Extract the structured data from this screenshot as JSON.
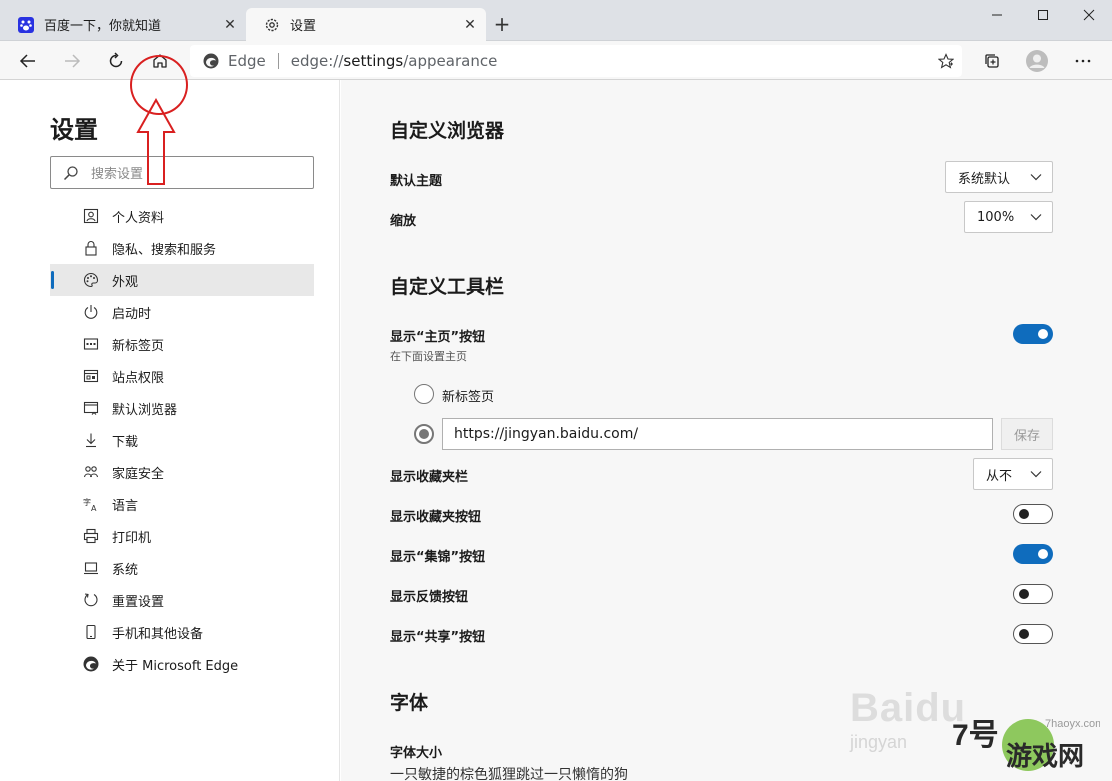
{
  "browser": {
    "tabs": [
      {
        "title": "百度一下，你就知道",
        "icon": "baidu-paw-icon",
        "active": false
      },
      {
        "title": "设置",
        "icon": "gear-icon",
        "active": true
      }
    ],
    "address": {
      "label": "Edge",
      "url_scheme": "edge://",
      "url_host": "settings",
      "url_path": "/appearance"
    }
  },
  "sidebar": {
    "title": "设置",
    "search_placeholder": "搜索设置",
    "items": [
      {
        "label": "个人资料",
        "icon": "profile-icon"
      },
      {
        "label": "隐私、搜索和服务",
        "icon": "lock-icon"
      },
      {
        "label": "外观",
        "icon": "palette-icon",
        "active": true
      },
      {
        "label": "启动时",
        "icon": "power-icon"
      },
      {
        "label": "新标签页",
        "icon": "new-tab-icon"
      },
      {
        "label": "站点权限",
        "icon": "site-permissions-icon"
      },
      {
        "label": "默认浏览器",
        "icon": "default-browser-icon"
      },
      {
        "label": "下载",
        "icon": "download-icon"
      },
      {
        "label": "家庭安全",
        "icon": "family-icon"
      },
      {
        "label": "语言",
        "icon": "language-icon"
      },
      {
        "label": "打印机",
        "icon": "printer-icon"
      },
      {
        "label": "系统",
        "icon": "system-icon"
      },
      {
        "label": "重置设置",
        "icon": "reset-icon"
      },
      {
        "label": "手机和其他设备",
        "icon": "phone-icon"
      },
      {
        "label": "关于 Microsoft Edge",
        "icon": "edge-logo-icon"
      }
    ]
  },
  "main": {
    "customize_browser": {
      "heading": "自定义浏览器",
      "theme_label": "默认主题",
      "theme_value": "系统默认",
      "zoom_label": "缩放",
      "zoom_value": "100%"
    },
    "customize_toolbar": {
      "heading": "自定义工具栏",
      "home_button_label": "显示“主页”按钮",
      "home_button_sub": "在下面设置主页",
      "home_button_on": true,
      "option_new_tab": "新标签页",
      "home_url": "https://jingyan.baidu.com/",
      "save_label": "保存",
      "favorites_bar_label": "显示收藏夹栏",
      "favorites_bar_value": "从不",
      "favorites_button_label": "显示收藏夹按钮",
      "favorites_button_on": false,
      "collections_button_label": "显示“集锦”按钮",
      "collections_button_on": true,
      "feedback_button_label": "显示反馈按钮",
      "feedback_button_on": false,
      "share_button_label": "显示“共享”按钮",
      "share_button_on": false
    },
    "fonts": {
      "heading": "字体",
      "size_label": "字体大小",
      "preview_text": "一只敏捷的棕色狐狸跳过一只懒惰的狗"
    }
  },
  "watermark": {
    "baidu": "Baidu",
    "jingyan": "jingyan",
    "site_number": "7号",
    "site_text": "游戏网",
    "site_domain": "7haoyx.com"
  },
  "colors": {
    "accent": "#0f6cbd",
    "annotation": "#d92020"
  }
}
